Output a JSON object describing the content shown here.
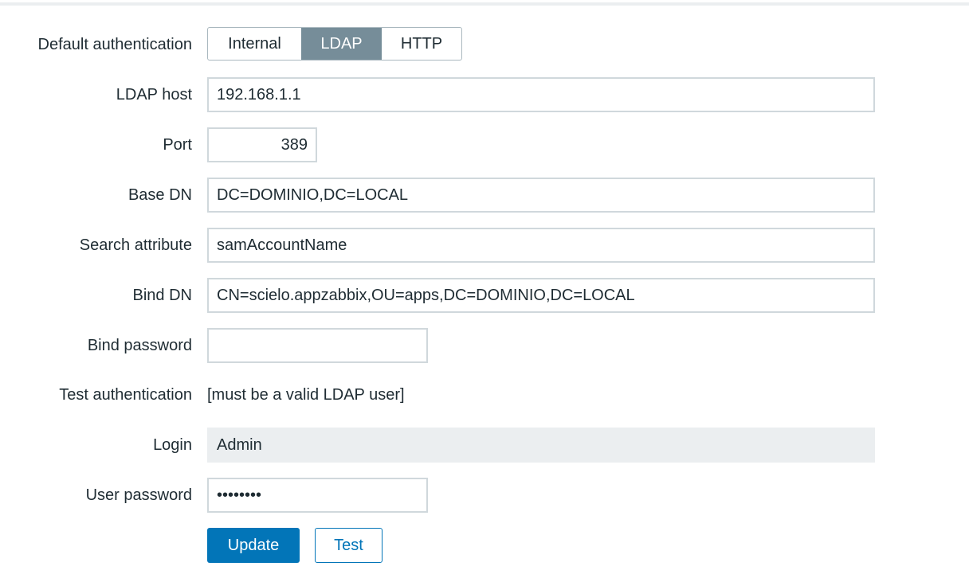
{
  "form": {
    "default_auth": {
      "label": "Default authentication",
      "options": [
        "Internal",
        "LDAP",
        "HTTP"
      ],
      "selected": "LDAP"
    },
    "ldap_host": {
      "label": "LDAP host",
      "value": "192.168.1.1"
    },
    "port": {
      "label": "Port",
      "value": "389"
    },
    "base_dn": {
      "label": "Base DN",
      "value": "DC=DOMINIO,DC=LOCAL"
    },
    "search_attribute": {
      "label": "Search attribute",
      "value": "samAccountName"
    },
    "bind_dn": {
      "label": "Bind DN",
      "value": "CN=scielo.appzabbix,OU=apps,DC=DOMINIO,DC=LOCAL"
    },
    "bind_password": {
      "label": "Bind password",
      "value": ""
    },
    "test_auth": {
      "label": "Test authentication",
      "note": "[must be a valid LDAP user]"
    },
    "login": {
      "label": "Login",
      "value": "Admin"
    },
    "user_password": {
      "label": "User password",
      "value": "••••••••"
    }
  },
  "buttons": {
    "update": "Update",
    "test": "Test"
  },
  "colors": {
    "accent": "#0275b8",
    "selected_segment": "#768d99"
  }
}
